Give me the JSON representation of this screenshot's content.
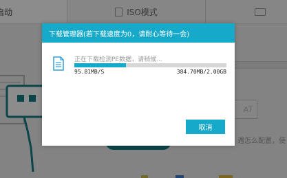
{
  "tabs": {
    "active_label": "启动",
    "iso_label": "ISO模式"
  },
  "background": {
    "button_label": "AT",
    "hint_text": "遇怎么配置，使"
  },
  "dialog": {
    "title": "下载管理器(若下载速度为0，请耐心等待一会)",
    "status": "正在下载检测PE数据，请稍候...",
    "speed": "95.81MB/S",
    "size": "384.70MB/2.00GB",
    "cancel_label": "取消",
    "progress_fraction": 0.34
  },
  "colors": {
    "accent": "#17a9c9",
    "dark_accent": "#137e86"
  },
  "icons": [
    "iso-icon",
    "monitor-icon",
    "file-icon",
    "usb-icon"
  ]
}
